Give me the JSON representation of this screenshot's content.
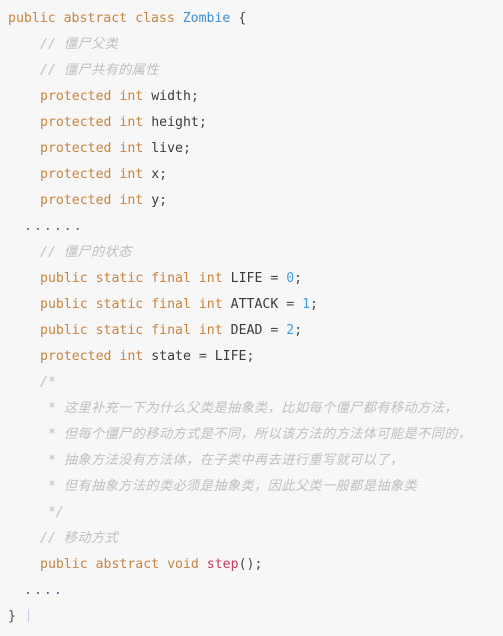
{
  "editor": {
    "language": "Java",
    "background_color": "#f7f7f7",
    "colors": {
      "keyword": "#c9843f",
      "class_name": "#3f8fd1",
      "identifier": "#3b3b3b",
      "number": "#3f9fe8",
      "method_name": "#cf3a62",
      "comment": "#bfbfbf",
      "ellipsis": "#5a5f8a"
    }
  },
  "code": {
    "lines": [
      {
        "id": "l1",
        "indent": 0,
        "tokens": [
          {
            "t": "public",
            "c": "kw"
          },
          {
            "t": " ",
            "c": "plain"
          },
          {
            "t": "abstract",
            "c": "kw"
          },
          {
            "t": " ",
            "c": "plain"
          },
          {
            "t": "class",
            "c": "kw"
          },
          {
            "t": " ",
            "c": "plain"
          },
          {
            "t": "Zombie",
            "c": "cls"
          },
          {
            "t": " {",
            "c": "punct"
          }
        ]
      },
      {
        "id": "l2",
        "indent": 2,
        "tokens": [
          {
            "t": "// ",
            "c": "cmt"
          },
          {
            "t": "僵尸父类",
            "c": "cmt-cn"
          }
        ]
      },
      {
        "id": "l3",
        "indent": 2,
        "tokens": [
          {
            "t": "// ",
            "c": "cmt"
          },
          {
            "t": "僵尸共有的属性",
            "c": "cmt-cn"
          }
        ]
      },
      {
        "id": "l4",
        "indent": 2,
        "tokens": [
          {
            "t": "protected",
            "c": "kw"
          },
          {
            "t": " ",
            "c": "plain"
          },
          {
            "t": "int",
            "c": "type"
          },
          {
            "t": " ",
            "c": "plain"
          },
          {
            "t": "width",
            "c": "plain"
          },
          {
            "t": ";",
            "c": "punct"
          }
        ]
      },
      {
        "id": "l5",
        "indent": 2,
        "tokens": [
          {
            "t": "protected",
            "c": "kw"
          },
          {
            "t": " ",
            "c": "plain"
          },
          {
            "t": "int",
            "c": "type"
          },
          {
            "t": " ",
            "c": "plain"
          },
          {
            "t": "height",
            "c": "plain"
          },
          {
            "t": ";",
            "c": "punct"
          }
        ]
      },
      {
        "id": "l6",
        "indent": 2,
        "tokens": [
          {
            "t": "protected",
            "c": "kw"
          },
          {
            "t": " ",
            "c": "plain"
          },
          {
            "t": "int",
            "c": "type"
          },
          {
            "t": " ",
            "c": "plain"
          },
          {
            "t": "live",
            "c": "plain"
          },
          {
            "t": ";",
            "c": "punct"
          }
        ]
      },
      {
        "id": "l7",
        "indent": 2,
        "tokens": [
          {
            "t": "protected",
            "c": "kw"
          },
          {
            "t": " ",
            "c": "plain"
          },
          {
            "t": "int",
            "c": "type"
          },
          {
            "t": " ",
            "c": "plain"
          },
          {
            "t": "x",
            "c": "plain"
          },
          {
            "t": ";",
            "c": "punct"
          }
        ]
      },
      {
        "id": "l8",
        "indent": 2,
        "tokens": [
          {
            "t": "protected",
            "c": "kw"
          },
          {
            "t": " ",
            "c": "plain"
          },
          {
            "t": "int",
            "c": "type"
          },
          {
            "t": " ",
            "c": "plain"
          },
          {
            "t": "y",
            "c": "plain"
          },
          {
            "t": ";",
            "c": "punct"
          }
        ]
      },
      {
        "id": "l9",
        "indent": 1,
        "tokens": [
          {
            "t": "......",
            "c": "dots"
          }
        ]
      },
      {
        "id": "l10",
        "indent": 2,
        "tokens": [
          {
            "t": "// ",
            "c": "cmt"
          },
          {
            "t": "僵尸的状态",
            "c": "cmt-cn"
          }
        ]
      },
      {
        "id": "l11",
        "indent": 2,
        "tokens": [
          {
            "t": "public",
            "c": "kw"
          },
          {
            "t": " ",
            "c": "plain"
          },
          {
            "t": "static",
            "c": "kw"
          },
          {
            "t": " ",
            "c": "plain"
          },
          {
            "t": "final",
            "c": "kw"
          },
          {
            "t": " ",
            "c": "plain"
          },
          {
            "t": "int",
            "c": "type"
          },
          {
            "t": " ",
            "c": "plain"
          },
          {
            "t": "LIFE",
            "c": "plain"
          },
          {
            "t": " = ",
            "c": "punct"
          },
          {
            "t": "0",
            "c": "num"
          },
          {
            "t": ";",
            "c": "punct"
          }
        ]
      },
      {
        "id": "l12",
        "indent": 2,
        "tokens": [
          {
            "t": "public",
            "c": "kw"
          },
          {
            "t": " ",
            "c": "plain"
          },
          {
            "t": "static",
            "c": "kw"
          },
          {
            "t": " ",
            "c": "plain"
          },
          {
            "t": "final",
            "c": "kw"
          },
          {
            "t": " ",
            "c": "plain"
          },
          {
            "t": "int",
            "c": "type"
          },
          {
            "t": " ",
            "c": "plain"
          },
          {
            "t": "ATTACK",
            "c": "plain"
          },
          {
            "t": " = ",
            "c": "punct"
          },
          {
            "t": "1",
            "c": "num"
          },
          {
            "t": ";",
            "c": "punct"
          }
        ]
      },
      {
        "id": "l13",
        "indent": 2,
        "tokens": [
          {
            "t": "public",
            "c": "kw"
          },
          {
            "t": " ",
            "c": "plain"
          },
          {
            "t": "static",
            "c": "kw"
          },
          {
            "t": " ",
            "c": "plain"
          },
          {
            "t": "final",
            "c": "kw"
          },
          {
            "t": " ",
            "c": "plain"
          },
          {
            "t": "int",
            "c": "type"
          },
          {
            "t": " ",
            "c": "plain"
          },
          {
            "t": "DEAD",
            "c": "plain"
          },
          {
            "t": " = ",
            "c": "punct"
          },
          {
            "t": "2",
            "c": "num"
          },
          {
            "t": ";",
            "c": "punct"
          }
        ]
      },
      {
        "id": "l14",
        "indent": 2,
        "tokens": [
          {
            "t": "protected",
            "c": "kw"
          },
          {
            "t": " ",
            "c": "plain"
          },
          {
            "t": "int",
            "c": "type"
          },
          {
            "t": " ",
            "c": "plain"
          },
          {
            "t": "state",
            "c": "plain"
          },
          {
            "t": " = ",
            "c": "punct"
          },
          {
            "t": "LIFE",
            "c": "plain"
          },
          {
            "t": ";",
            "c": "punct"
          }
        ]
      },
      {
        "id": "l15",
        "indent": 2,
        "tokens": [
          {
            "t": "/*",
            "c": "cmt"
          }
        ]
      },
      {
        "id": "l16",
        "indent": 2,
        "tokens": [
          {
            "t": " * ",
            "c": "cmt"
          },
          {
            "t": "这里补充一下为什么父类是抽象类，比如每个僵尸都有移动方法，",
            "c": "cmt-cn"
          }
        ]
      },
      {
        "id": "l17",
        "indent": 2,
        "tokens": [
          {
            "t": " * ",
            "c": "cmt"
          },
          {
            "t": "但每个僵尸的移动方式是不同，所以该方法的方法体可能是不同的，",
            "c": "cmt-cn"
          }
        ]
      },
      {
        "id": "l18",
        "indent": 2,
        "tokens": [
          {
            "t": " * ",
            "c": "cmt"
          },
          {
            "t": "抽象方法没有方法体，在子类中再去进行重写就可以了，",
            "c": "cmt-cn"
          }
        ]
      },
      {
        "id": "l19",
        "indent": 2,
        "tokens": [
          {
            "t": " * ",
            "c": "cmt"
          },
          {
            "t": "但有抽象方法的类必须是抽象类，因此父类一般都是抽象类",
            "c": "cmt-cn"
          }
        ]
      },
      {
        "id": "l20",
        "indent": 2,
        "tokens": [
          {
            "t": " */",
            "c": "cmt"
          }
        ]
      },
      {
        "id": "l21",
        "indent": 2,
        "tokens": [
          {
            "t": "// ",
            "c": "cmt"
          },
          {
            "t": "移动方式",
            "c": "cmt-cn"
          }
        ]
      },
      {
        "id": "l22",
        "indent": 2,
        "tokens": [
          {
            "t": "public",
            "c": "kw"
          },
          {
            "t": " ",
            "c": "plain"
          },
          {
            "t": "abstract",
            "c": "kw"
          },
          {
            "t": " ",
            "c": "plain"
          },
          {
            "t": "void",
            "c": "kw"
          },
          {
            "t": " ",
            "c": "plain"
          },
          {
            "t": "step",
            "c": "fn"
          },
          {
            "t": "();",
            "c": "punct"
          }
        ]
      },
      {
        "id": "l23",
        "indent": 1,
        "tokens": [
          {
            "t": "....",
            "c": "dots"
          }
        ]
      },
      {
        "id": "l24",
        "indent": 0,
        "tokens": [
          {
            "t": "}",
            "c": "punct"
          }
        ]
      }
    ]
  }
}
